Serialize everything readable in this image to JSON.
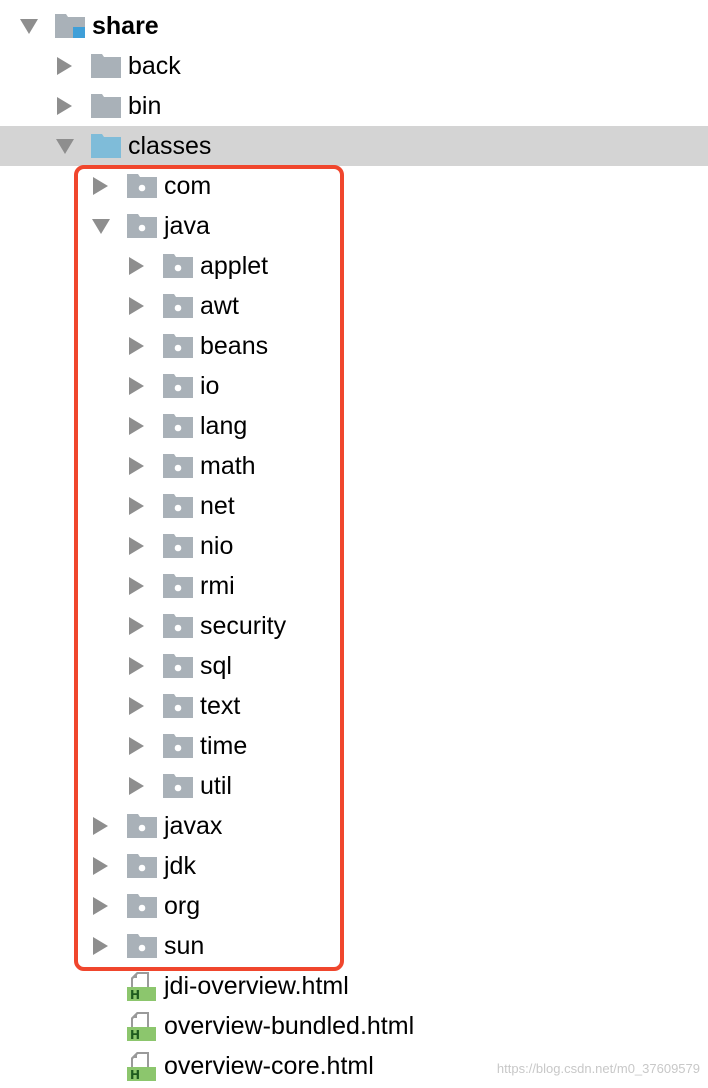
{
  "tree": {
    "root": {
      "label": "share",
      "icon": "module-folder-icon",
      "expanded": true
    },
    "rows": [
      {
        "id": "back",
        "label": "back",
        "depth": 1,
        "type": "folder",
        "expanded": false
      },
      {
        "id": "bin",
        "label": "bin",
        "depth": 1,
        "type": "folder",
        "expanded": false
      },
      {
        "id": "classes",
        "label": "classes",
        "depth": 1,
        "type": "source-folder",
        "expanded": true,
        "selected": true
      },
      {
        "id": "com",
        "label": "com",
        "depth": 2,
        "type": "package",
        "expanded": false
      },
      {
        "id": "java",
        "label": "java",
        "depth": 2,
        "type": "package",
        "expanded": true
      },
      {
        "id": "applet",
        "label": "applet",
        "depth": 3,
        "type": "package",
        "expanded": false
      },
      {
        "id": "awt",
        "label": "awt",
        "depth": 3,
        "type": "package",
        "expanded": false
      },
      {
        "id": "beans",
        "label": "beans",
        "depth": 3,
        "type": "package",
        "expanded": false
      },
      {
        "id": "io",
        "label": "io",
        "depth": 3,
        "type": "package",
        "expanded": false
      },
      {
        "id": "lang",
        "label": "lang",
        "depth": 3,
        "type": "package",
        "expanded": false
      },
      {
        "id": "math",
        "label": "math",
        "depth": 3,
        "type": "package",
        "expanded": false
      },
      {
        "id": "net",
        "label": "net",
        "depth": 3,
        "type": "package",
        "expanded": false
      },
      {
        "id": "nio",
        "label": "nio",
        "depth": 3,
        "type": "package",
        "expanded": false
      },
      {
        "id": "rmi",
        "label": "rmi",
        "depth": 3,
        "type": "package",
        "expanded": false
      },
      {
        "id": "security",
        "label": "security",
        "depth": 3,
        "type": "package",
        "expanded": false
      },
      {
        "id": "sql",
        "label": "sql",
        "depth": 3,
        "type": "package",
        "expanded": false
      },
      {
        "id": "text",
        "label": "text",
        "depth": 3,
        "type": "package",
        "expanded": false
      },
      {
        "id": "time",
        "label": "time",
        "depth": 3,
        "type": "package",
        "expanded": false
      },
      {
        "id": "util",
        "label": "util",
        "depth": 3,
        "type": "package",
        "expanded": false
      },
      {
        "id": "javax",
        "label": "javax",
        "depth": 2,
        "type": "package",
        "expanded": false
      },
      {
        "id": "jdk",
        "label": "jdk",
        "depth": 2,
        "type": "package",
        "expanded": false
      },
      {
        "id": "org",
        "label": "org",
        "depth": 2,
        "type": "package",
        "expanded": false
      },
      {
        "id": "sun",
        "label": "sun",
        "depth": 2,
        "type": "package",
        "expanded": false
      },
      {
        "id": "jdi-overview",
        "label": "jdi-overview.html",
        "depth": 2,
        "type": "html-file"
      },
      {
        "id": "overview-bundled",
        "label": "overview-bundled.html",
        "depth": 2,
        "type": "html-file"
      },
      {
        "id": "overview-core",
        "label": "overview-core.html",
        "depth": 2,
        "type": "html-file"
      }
    ]
  },
  "watermark": "https://blog.csdn.net/m0_37609579",
  "colors": {
    "arrow": "#8e8e8e",
    "folder": "#a9b1b8",
    "source_folder": "#7fbcd9",
    "module_badge": "#3f9fd8",
    "html_badge": "#8cc66d",
    "selection": "#d4d4d4",
    "highlight_border": "#f0462d"
  }
}
